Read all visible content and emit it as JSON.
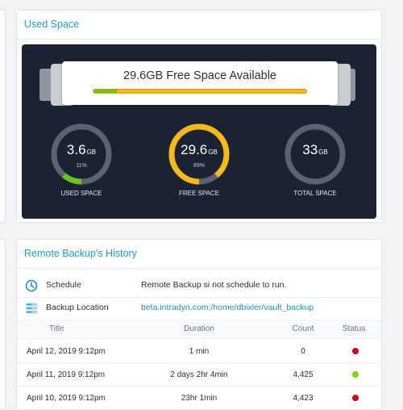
{
  "used_space": {
    "title": "Used Space",
    "banner_text": "29.6GB Free Space Available",
    "used_fraction": 0.11,
    "gauges": [
      {
        "value": "3.6",
        "unit": "GB",
        "percent": "11%",
        "label": "USED SPACE",
        "fill": 0.11,
        "color": "#6dc31f"
      },
      {
        "value": "29.6",
        "unit": "GB",
        "percent": "89%",
        "label": "FREE SPACE",
        "fill": 0.89,
        "color": "#f5b918"
      },
      {
        "value": "33",
        "unit": "GB",
        "percent": "",
        "label": "TOTAL SPACE",
        "fill": 0,
        "color": "#6b7280"
      }
    ]
  },
  "history": {
    "title": "Remote Backup's History",
    "schedule": {
      "label": "Schedule",
      "value": "Remote Backup si not schedule to run."
    },
    "location": {
      "label": "Backup Location",
      "value": "beta.intradyn.com:/home/dbixler/vault_backup"
    },
    "columns": {
      "title": "Title",
      "duration": "Duration",
      "count": "Count",
      "status": "Status"
    },
    "rows": [
      {
        "title": "April 12, 2019 9:12pm",
        "duration": "1 min",
        "count": "0",
        "status_color": "#d0021b"
      },
      {
        "title": "April 11, 2019 9:12pm",
        "duration": "2 days 2hr 4min",
        "count": "4,425",
        "status_color": "#7ed321"
      },
      {
        "title": "April 10, 2019 9:12pm",
        "duration": "23hr 1min",
        "count": "4,423",
        "status_color": "#d0021b"
      }
    ]
  },
  "colors": {
    "accent": "#1fa0c9",
    "dashboard_bg": "#1b2332",
    "used": "#6dc31f",
    "free": "#f5b918",
    "track": "#5b6270"
  }
}
